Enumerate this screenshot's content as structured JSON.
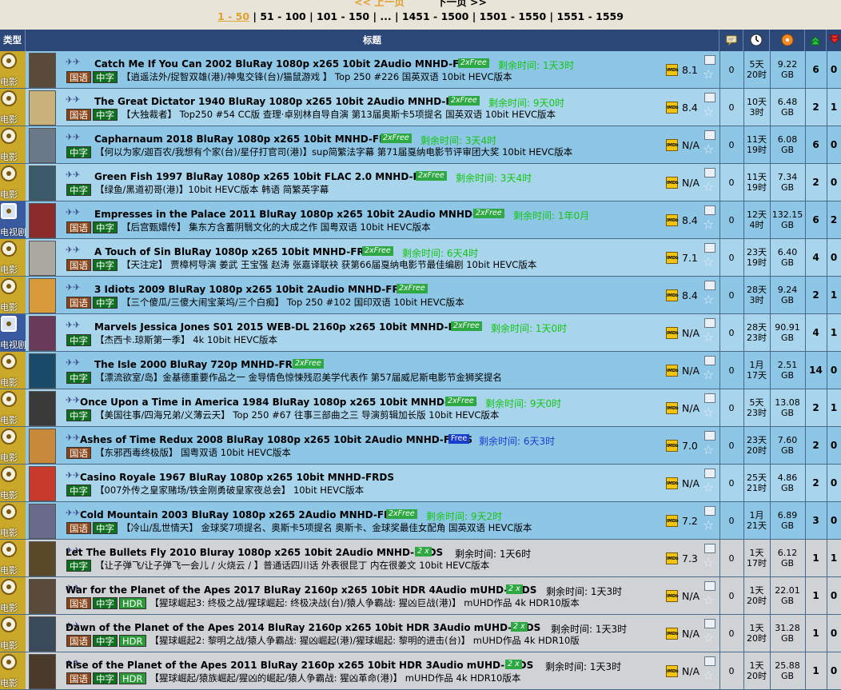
{
  "pager": {
    "prev": "<< 上一页",
    "next": "下一页 >>",
    "ranges": [
      "1 - 50",
      "51 - 100",
      "101 - 150",
      "...",
      "1451 - 1500",
      "1501 - 1550",
      "1551 - 1559"
    ]
  },
  "header": {
    "type": "类型",
    "title": "标题",
    "icons": [
      "comments-icon",
      "clock-icon",
      "size-icon",
      "seeders-icon",
      "leechers-icon"
    ]
  },
  "colors": {
    "header_bg": "#2c4878",
    "free_badge": "#2ea843",
    "free_blue": "#1a3ecc",
    "countdown": "#12c212"
  },
  "rows": [
    {
      "cat": "电影",
      "title": "Catch Me If You Can 2002 BluRay 1080p x265 10bit 2Audio MNHD-FRDS",
      "badge": "2xFree",
      "badge_style": "green",
      "remain": "剩余时间: 1天3时",
      "remain_color": "#13c613",
      "tags": [
        "国语",
        "中字"
      ],
      "sub": "【逍遥法外/捉智双雄(港)/神鬼交锋(台)/猫鼠游戏 】 Top 250 #226 国英双语 10bit HEVC版本",
      "rating": "8.1",
      "comments": "0",
      "age": "5天\n20时",
      "size": "9.22\nGB",
      "seeders": "6",
      "leechers": "0",
      "bg": "mid"
    },
    {
      "cat": "电影",
      "title": "The Great Dictator 1940 BluRay 1080p x265 10bit 2Audio MNHD-FRDS",
      "badge": "2xFree",
      "badge_style": "green",
      "remain": "剩余时间: 9天0时",
      "remain_color": "#13c613",
      "tags": [
        "国语",
        "中字"
      ],
      "sub": "【大独裁者】 Top250 #54 CC版 查理·卓别林自导自演 第13届奥斯卡5项提名 国英双语 10bit HEVC版本",
      "rating": "8.4",
      "comments": "0",
      "age": "10天\n3时",
      "size": "6.48\nGB",
      "seeders": "2",
      "leechers": "1",
      "bg": "light"
    },
    {
      "cat": "电影",
      "title": "Capharnaum 2018 BluRay 1080p x265 10bit MNHD-FRDS",
      "badge": "2xFree",
      "badge_style": "green",
      "remain": "剩余时间: 3天4时",
      "remain_color": "#13c613",
      "tags": [
        "中字"
      ],
      "sub": "【何以为家/迦百农/我想有个家(台)/星仔打官司(港)】sup简繁法字幕 第71届戛纳电影节评审团大奖 10bit HEVC版本",
      "rating": "N/A",
      "comments": "0",
      "age": "11天\n19时",
      "size": "6.08\nGB",
      "seeders": "6",
      "leechers": "0",
      "bg": "mid"
    },
    {
      "cat": "电影",
      "title": "Green Fish 1997 BluRay 1080p x265 10bit FLAC 2.0 MNHD-FRDS",
      "badge": "2xFree",
      "badge_style": "green",
      "remain": "剩余时间: 3天4时",
      "remain_color": "#13c613",
      "tags": [
        "中字"
      ],
      "sub": "【绿鱼/黑道初哥(港)】10bit HEVC版本 韩语 简繁英字幕",
      "rating": "N/A",
      "comments": "0",
      "age": "11天\n19时",
      "size": "7.34\nGB",
      "seeders": "2",
      "leechers": "0",
      "bg": "light"
    },
    {
      "cat": "电视剧",
      "title": "Empresses in the Palace 2011 BluRay 1080p x265 10bit 2Audio MNHD-FRDS",
      "badge": "2xFree",
      "badge_style": "green",
      "remain": "剩余时间: 1年0月",
      "remain_color": "#13c613",
      "tags": [
        "国语",
        "中字"
      ],
      "sub": "【后宫甄嬛传】 集东方含蓄阴翳文化的大成之作 国粤双语 10bit HEVC版本",
      "rating": "8.4",
      "comments": "0",
      "age": "12天\n4时",
      "size": "132.15\nGB",
      "seeders": "6",
      "leechers": "2",
      "bg": "mid"
    },
    {
      "cat": "电影",
      "title": "A Touch of Sin BluRay 1080p x265 10bit MNHD-FRDS",
      "badge": "2xFree",
      "badge_style": "green",
      "remain": "剩余时间: 6天4时",
      "remain_color": "#13c613",
      "tags": [
        "国语",
        "中字"
      ],
      "sub": "【天注定】 贾樟柯导演 姜武 王宝强 赵涛 张嘉译联袂 获第66届戛纳电影节最佳编剧 10bit HEVC版本",
      "rating": "7.1",
      "comments": "0",
      "age": "23天\n19时",
      "size": "6.40\nGB",
      "seeders": "4",
      "leechers": "0",
      "bg": "light"
    },
    {
      "cat": "电影",
      "title": "3 Idiots 2009 BluRay 1080p x265 10bit 2Audio MNHD-FRDS",
      "badge": "2xFree",
      "badge_style": "green",
      "remain": "",
      "remain_color": "#13c613",
      "tags": [
        "国语",
        "中字"
      ],
      "sub": "【三个傻瓜/三傻大闹宝莱坞/三个白痴】 Top 250 #102 国印双语 10bit HEVC版本",
      "rating": "8.4",
      "comments": "0",
      "age": "28天\n3时",
      "size": "9.24\nGB",
      "seeders": "2",
      "leechers": "1",
      "bg": "mid"
    },
    {
      "cat": "电视剧",
      "title": "Marvels Jessica Jones S01 2015 WEB-DL 2160p x265 10bit MNHD-FRDS",
      "badge": "2xFree",
      "badge_style": "green",
      "remain": "剩余时间: 1天0时",
      "remain_color": "#13c613",
      "tags": [
        "中字"
      ],
      "sub": "【杰西卡.琼斯第一季】 4k 10bit HEVC版本",
      "rating": "N/A",
      "comments": "0",
      "age": "28天\n23时",
      "size": "90.91\nGB",
      "seeders": "4",
      "leechers": "1",
      "bg": "light"
    },
    {
      "cat": "电影",
      "title": "The Isle 2000 BluRay 720p MNHD-FRDS",
      "badge": "2xFree",
      "badge_style": "green",
      "remain": "",
      "remain_color": "#13c613",
      "tags": [
        "中字"
      ],
      "sub": "【漂流欲室/岛】金基德重要作品之一 金导情色惊悚残忍美学代表作 第57届威尼斯电影节金狮奖提名",
      "rating": "N/A",
      "comments": "0",
      "age": "1月\n17天",
      "size": "2.51\nGB",
      "seeders": "14",
      "leechers": "0",
      "bg": "mid"
    },
    {
      "cat": "电影",
      "title": "Once Upon a Time in America 1984 BluRay 1080p x265 10bit MNHD-FRDS",
      "badge": "2xFree",
      "badge_style": "green",
      "remain": "剩余时间: 9天0时",
      "remain_color": "#13c613",
      "tags": [
        "中字"
      ],
      "sub": "【美国往事/四海兄弟/义薄云天】 Top 250 #67 往事三部曲之三 导演剪辑加长版 10bit HEVC版本",
      "rating": "N/A",
      "comments": "0",
      "age": "5天\n23时",
      "size": "13.08\nGB",
      "seeders": "2",
      "leechers": "1",
      "bg": "light"
    },
    {
      "cat": "电影",
      "title": "Ashes of Time Redux 2008 BluRay 1080p x265 10bit 2Audio MNHD-FRDS",
      "badge": "Free",
      "badge_style": "blue",
      "remain": "剩余时间: 6天3时",
      "remain_color": "#1a3ecc",
      "tags": [
        "国语"
      ],
      "sub": "【东邪西毒终极版】 国粤双语 10bit HEVC版本",
      "rating": "7.0",
      "comments": "0",
      "age": "23天\n20时",
      "size": "7.60\nGB",
      "seeders": "2",
      "leechers": "0",
      "bg": "mid"
    },
    {
      "cat": "电影",
      "title": "Casino Royale 1967 BluRay 1080p x265 10bit MNHD-FRDS",
      "badge": "",
      "badge_style": "",
      "remain": "",
      "remain_color": "#000",
      "tags": [
        "中字"
      ],
      "sub": "【007外传之皇家赌场/铁金刚勇破皇家夜总会】 10bit HEVC版本",
      "rating": "N/A",
      "comments": "0",
      "age": "25天\n21时",
      "size": "4.86\nGB",
      "seeders": "2",
      "leechers": "0",
      "bg": "light"
    },
    {
      "cat": "电影",
      "title": "Cold Mountain 2003 BluRay 1080p x265 2Audio MNHD-FRDS",
      "badge": "2xFree",
      "badge_style": "green",
      "remain": "剩余时间: 9天2时",
      "remain_color": "#13c613",
      "tags": [
        "国语",
        "中字"
      ],
      "sub": "【冷山/乱世情天】 金球奖7项提名、奥斯卡5项提名 奥斯卡、金球奖最佳女配角 国英双语 HEVC版本",
      "rating": "7.2",
      "comments": "0",
      "age": "1月\n21天",
      "size": "6.89\nGB",
      "seeders": "3",
      "leechers": "0",
      "bg": "mid"
    },
    {
      "cat": "电影",
      "title": "Let The Bullets Fly 2010 Bluray 1080p x265 10bit 2Audio MNHD-FRDS",
      "badge": "2 x",
      "badge_style": "green",
      "remain": "剩余时间: 1天6时",
      "remain_color": "#000",
      "tags": [
        "中字"
      ],
      "sub": "【让子弹飞/让子弹飞一会儿 / 火烧云 / 】普通话四川话 外表很昆丁 内在很姜文 10bit HEVC版本",
      "rating": "7.3",
      "comments": "0",
      "age": "1天\n17时",
      "size": "6.12\nGB",
      "seeders": "1",
      "leechers": "1",
      "bg": "gray"
    },
    {
      "cat": "电影",
      "title": "War for the Planet of the Apes 2017 BluRay 2160p x265 10bit HDR 4Audio mUHD-FRDS",
      "badge": "2 x",
      "badge_style": "green",
      "remain": "剩余时间: 1天3时",
      "remain_color": "#000",
      "tags": [
        "国语",
        "中字",
        "HDR"
      ],
      "sub": "【猩球崛起3: 终极之战/猩球崛起: 终极决战(台)/猿人争霸战: 猩凶巨战(港)】 mUHD作品 4k HDR10版本",
      "rating": "N/A",
      "comments": "0",
      "age": "1天\n20时",
      "size": "22.01\nGB",
      "seeders": "1",
      "leechers": "0",
      "bg": "gray"
    },
    {
      "cat": "电影",
      "title": "Dawn of the Planet of the Apes 2014 BluRay 2160p x265 10bit HDR 3Audio mUHD-FRDS",
      "badge": "2 x",
      "badge_style": "green",
      "remain": "剩余时间: 1天3时",
      "remain_color": "#000",
      "tags": [
        "国语",
        "中字",
        "HDR"
      ],
      "sub": "【猩球崛起2: 黎明之战/猿人争霸战: 猩凶崛起(港)/猩球崛起: 黎明的进击(台)】 mUHD作品 4k HDR10版",
      "rating": "N/A",
      "comments": "0",
      "age": "1天\n20时",
      "size": "31.28\nGB",
      "seeders": "1",
      "leechers": "0",
      "bg": "gray"
    },
    {
      "cat": "电影",
      "title": "Rise of the Planet of the Apes 2011 BluRay 2160p x265 10bit HDR 3Audio mUHD-FRDS",
      "badge": "2 x",
      "badge_style": "green",
      "remain": "剩余时间: 1天3时",
      "remain_color": "#000",
      "tags": [
        "国语",
        "中字",
        "HDR"
      ],
      "sub": "【猩球崛起/猿族崛起/猩凶的崛起/猿人争霸战: 猩凶革命(港)】 mUHD作品 4k HDR10版本",
      "rating": "N/A",
      "comments": "0",
      "age": "1天\n20时",
      "size": "25.88\nGB",
      "seeders": "1",
      "leechers": "0",
      "bg": "gray"
    }
  ]
}
